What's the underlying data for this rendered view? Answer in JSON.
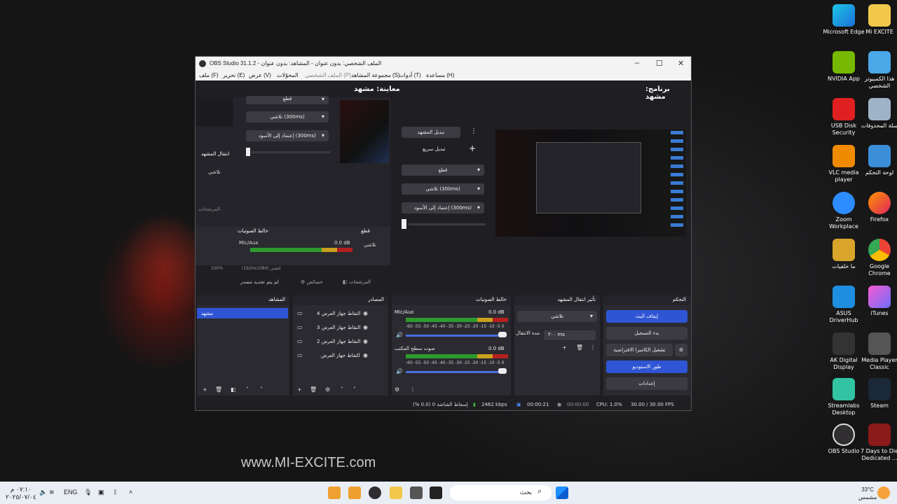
{
  "window": {
    "title": "OBS Studio 31.1.2 - الملف الشخصي: بدون عنوان - المشاهد: بدون عنوان",
    "min": "–",
    "max": "☐",
    "close": "✕"
  },
  "menu": [
    "ملف (F)",
    "تحرير (E)",
    "عرض (V)",
    "المحوّلات",
    "الملف الشخصي (P)",
    "مجموعة المشاهد (S)",
    "أدوات (T)",
    "مساعدة (H)"
  ],
  "preview": {
    "label": "معاينة: مشهد",
    "program_label": "برنامج: مشهد"
  },
  "inner": {
    "transition_dd_top": "قطع",
    "fade_dd": "تلاشي (300ms)",
    "black_dd": "إعتماد إلى الأسود (300ms)",
    "scene_transitions": "انتقال المشهد",
    "fade": "تلاشي",
    "filters": "المرشحات",
    "audio_mixer": "خالط الصوتيات",
    "mic": "Mic/Aux",
    "db": "0.0 dB",
    "zoom": "100%",
    "canvas": "(1920x1080) كنفس",
    "cut_label": "قطع"
  },
  "transition_panel": {
    "change_scene": "تبديل المشهد",
    "quick": "تبديل سريع",
    "cut": "قطع",
    "fade": "تلاشي (300ms)",
    "black": "إعتماد إلى الأسود (300ms)"
  },
  "toolbar": {
    "no_source": "لم يتم تحديد مصدر",
    "properties": "خصائص",
    "filters": "المرشحات"
  },
  "scenes": {
    "title": "المشاهد",
    "items": [
      "مشهد"
    ]
  },
  "sources": {
    "title": "المصادر",
    "items": [
      "التقاط جهاز العرض 4",
      "التقاط جهاز العرض 3",
      "التقاط جهاز العرض 2",
      "التقاط جهاز العرض"
    ]
  },
  "mixer": {
    "title": "خالط الصوتيات",
    "channels": [
      {
        "name": "Mic/Aux",
        "db": "0.0 dB"
      },
      {
        "name": "صوت سطح المكتب",
        "db": "0.0 dB"
      }
    ],
    "ticks": "-60 -55 -50 -45 -40 -35 -30 -25 -20 -15 -10 -5 0"
  },
  "transitions": {
    "title": "تأثير انتقال المشهد",
    "selected": "تلاشي",
    "duration_label": "مدة الانتقال",
    "duration": "٣٠٠ ms"
  },
  "controls": {
    "title": "التحكم",
    "start_stream": "إيقاف البث",
    "start_record": "بدء التسجيل",
    "virtual_cam": "تشغيل الكاميرا الافتراضية",
    "studio_mode": "طور الاستوديو",
    "settings": "إعدادات"
  },
  "status": {
    "dropped": "إسقاط الشاشة 0 (0.0 %)",
    "kbps": "2462 kbps",
    "stream_time": "00:00:21",
    "rec_time": "00:00:00",
    "cpu": "CPU: 1.0%",
    "fps": "30.00 / 30.00 FPS"
  },
  "desktop": [
    "Microsoft Edge",
    "Mi EXCITE",
    "NVIDIA App",
    "هذا الكمبيوتر الشخصي",
    "USB Disk Security",
    "سلة المحذوفات",
    "VLC media player",
    "لوحة التحكم",
    "Zoom Workplace",
    "Firefox",
    "ما خلفيات",
    "Google Chrome",
    "ASUS DriverHub",
    "iTunes",
    "AK Digital Display",
    "Media Player Classic",
    "Streamlabs Desktop",
    "Steam",
    "OBS Studio",
    "7 Days to Die Dedicated ..."
  ],
  "watermark": "www.MI-EXCITE.com",
  "taskbar": {
    "time": "٠٧:١٠ م",
    "date": "٢٠٢٥/٠٧/٠٤",
    "lang": "ENG",
    "search": "بحث",
    "weather": "33°C",
    "weather_desc": "مشمس"
  }
}
